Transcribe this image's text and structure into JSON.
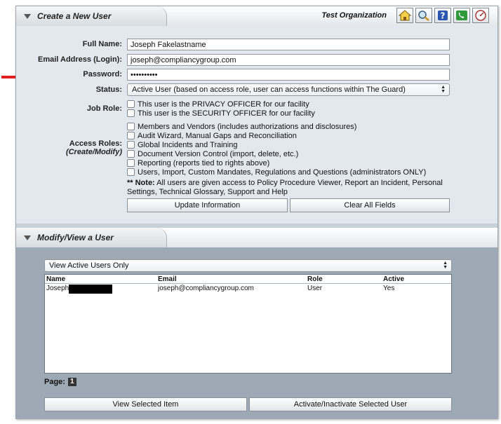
{
  "create": {
    "title": "Create a New User",
    "organization": "Test Organization",
    "toolbar": [
      {
        "icon": "home-icon",
        "name": "home-button"
      },
      {
        "icon": "search-icon",
        "name": "search-button"
      },
      {
        "icon": "help-icon",
        "name": "help-button"
      },
      {
        "icon": "phone-icon",
        "name": "phone-button"
      },
      {
        "icon": "dashboard-icon",
        "name": "dashboard-button"
      }
    ],
    "labels": {
      "full_name": "Full Name:",
      "email": "Email Address (Login):",
      "password": "Password:",
      "status": "Status:",
      "job_role": "Job Role:",
      "access_roles": "Access Roles:",
      "access_roles_sub": "(Create/Modify)"
    },
    "values": {
      "full_name": "Joseph Fakelastname",
      "email": "joseph@compliancygroup.com",
      "password": "••••••••••",
      "status": "Active User (based on access role, user can access functions within The Guard)"
    },
    "job_roles": [
      "This user is the PRIVACY OFFICER for our facility",
      "This user is the SECURITY OFFICER for our facility"
    ],
    "access_roles": [
      "Members and Vendors (includes authorizations and disclosures)",
      "Audit Wizard, Manual Gaps and Reconciliation",
      "Global Incidents and Training",
      "Document Version Control (import, delete, etc.)",
      "Reporting (reports tied to rights above)",
      "Users, Import, Custom Mandates, Regulations and Questions (administrators ONLY)"
    ],
    "note_prefix": "** Note:",
    "note_text": " All users are given access to Policy Procedure Viewer, Report an Incident, Personal Settings, Technical Glossary, Support and Help",
    "update_button": "Update Information",
    "clear_button": "Clear All Fields"
  },
  "modify": {
    "title": "Modify/View a User",
    "filter": "View Active Users Only",
    "columns": [
      "Name",
      "Email",
      "Role",
      "Active"
    ],
    "rows": [
      {
        "name": "Joseph",
        "email": "joseph@compliancygroup.com",
        "role": "User",
        "active": "Yes"
      }
    ],
    "page_label": "Page:",
    "page_number": "1",
    "view_button": "View Selected Item",
    "activate_button": "Activate/Inactivate Selected User"
  },
  "colors": {
    "annotation_arrow": "#e02020",
    "create_bg": "#e2e8ee",
    "modify_bg": "#9daab6"
  }
}
